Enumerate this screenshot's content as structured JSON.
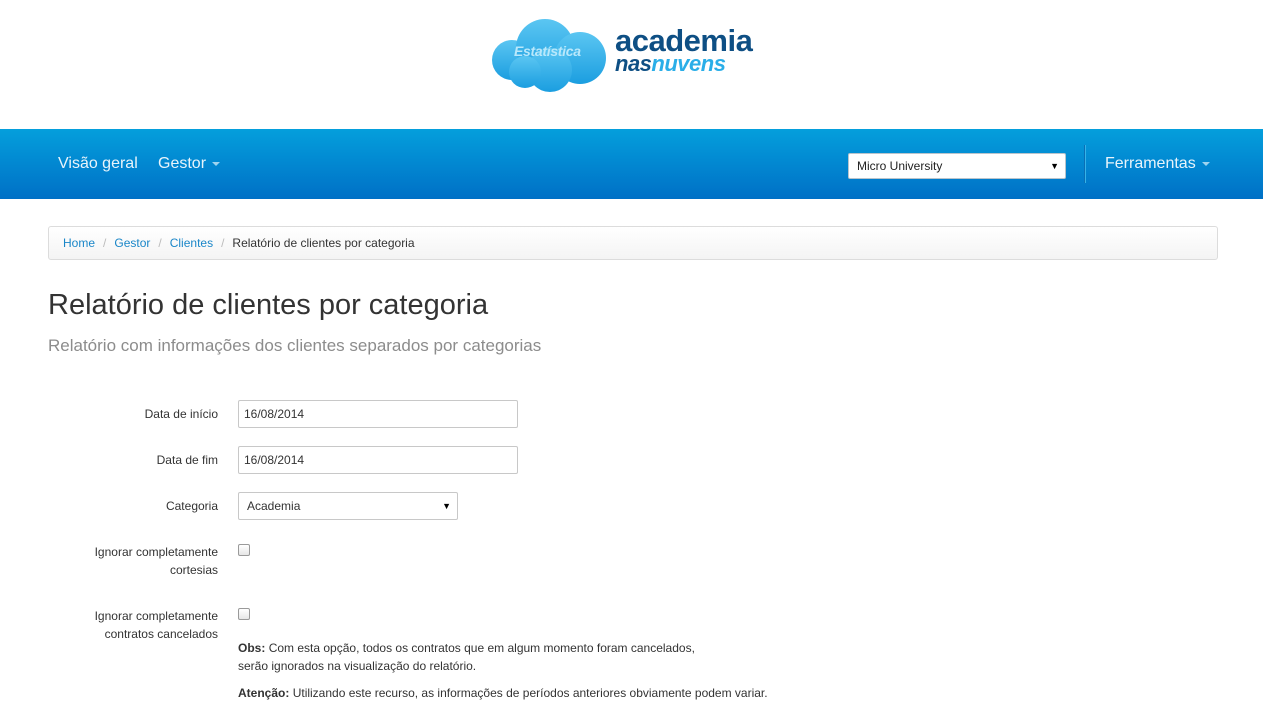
{
  "logo": {
    "cloud_text": "Estatística",
    "word1": "academia",
    "word2a": "nas",
    "word2b": "nuvens"
  },
  "navbar": {
    "items": [
      "Visão geral",
      "Gestor"
    ],
    "unit_select": "Micro University",
    "tools": "Ferramentas"
  },
  "breadcrumb": {
    "home": "Home",
    "gestor": "Gestor",
    "clientes": "Clientes",
    "current": "Relatório de clientes por categoria",
    "separator": "/"
  },
  "page": {
    "title": "Relatório de clientes por categoria",
    "subtitle": "Relatório com informações dos clientes separados por categorias"
  },
  "form": {
    "start_label": "Data de início",
    "start_value": "16/08/2014",
    "end_label": "Data de fim",
    "end_value": "16/08/2014",
    "category_label": "Categoria",
    "category_value": "Academia",
    "courtesy_label_1": "Ignorar completamente",
    "courtesy_label_2": "cortesias",
    "cancelled_label_1": "Ignorar completamente",
    "cancelled_label_2": "contratos cancelados",
    "obs_label": "Obs:",
    "obs_line1": "Com esta opção, todos os contratos que em algum momento foram cancelados,",
    "obs_line2": "serão ignorados na visualização do relatório.",
    "warn_label": "Atenção:",
    "warn_text": "Utilizando este recurso, as informações de períodos anteriores obviamente podem variar."
  },
  "colors": {
    "navbar_top": "#049fdc",
    "navbar_bottom": "#0070c6",
    "link": "#1a86c8",
    "logo_dark": "#0e4f84",
    "logo_light": "#2aaee8"
  },
  "icons": {
    "dropdown_caret": "caret-down-icon",
    "select_arrow": "triangle-down-icon"
  }
}
